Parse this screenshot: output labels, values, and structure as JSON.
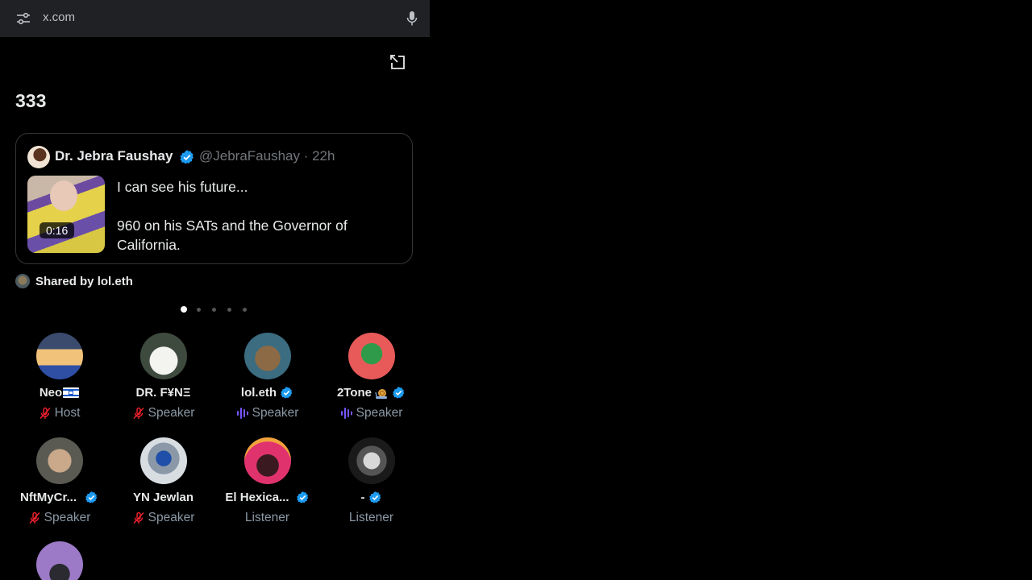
{
  "browser": {
    "url": "x.com"
  },
  "space": {
    "title": "333"
  },
  "post": {
    "author_name": "Dr. Jebra Faushay",
    "handle_time": "@JebraFaushay · 22h",
    "video_duration": "0:16",
    "text_line1": "I can see his future...",
    "text_line2": "960 on his SATs and the Governor of California."
  },
  "shared_by": "Shared by lol.eth",
  "pagination": {
    "total": 5,
    "active": 0
  },
  "participants": [
    {
      "name": "Neo",
      "role": "Host",
      "status": "muted",
      "verified": false
    },
    {
      "name": "DR. F¥NΞ",
      "role": "Speaker",
      "status": "muted",
      "verified": false
    },
    {
      "name": "lol.eth",
      "role": "Speaker",
      "status": "speaking",
      "verified": true
    },
    {
      "name": "2Tone",
      "role": "Speaker",
      "status": "speaking",
      "verified": true
    },
    {
      "name": "NftMyCr...",
      "role": "Speaker",
      "status": "muted",
      "verified": true
    },
    {
      "name": "YN Jewlan",
      "role": "Speaker",
      "status": "muted",
      "verified": false
    },
    {
      "name": "El Hexica...",
      "role": "Listener",
      "status": "none",
      "verified": true
    },
    {
      "name": "-",
      "role": "Listener",
      "status": "none",
      "verified": true
    }
  ],
  "colors": {
    "verified": "#1d9bf0",
    "muted": "#f4212e",
    "speaking": "#7856ff",
    "background": "#000000"
  }
}
